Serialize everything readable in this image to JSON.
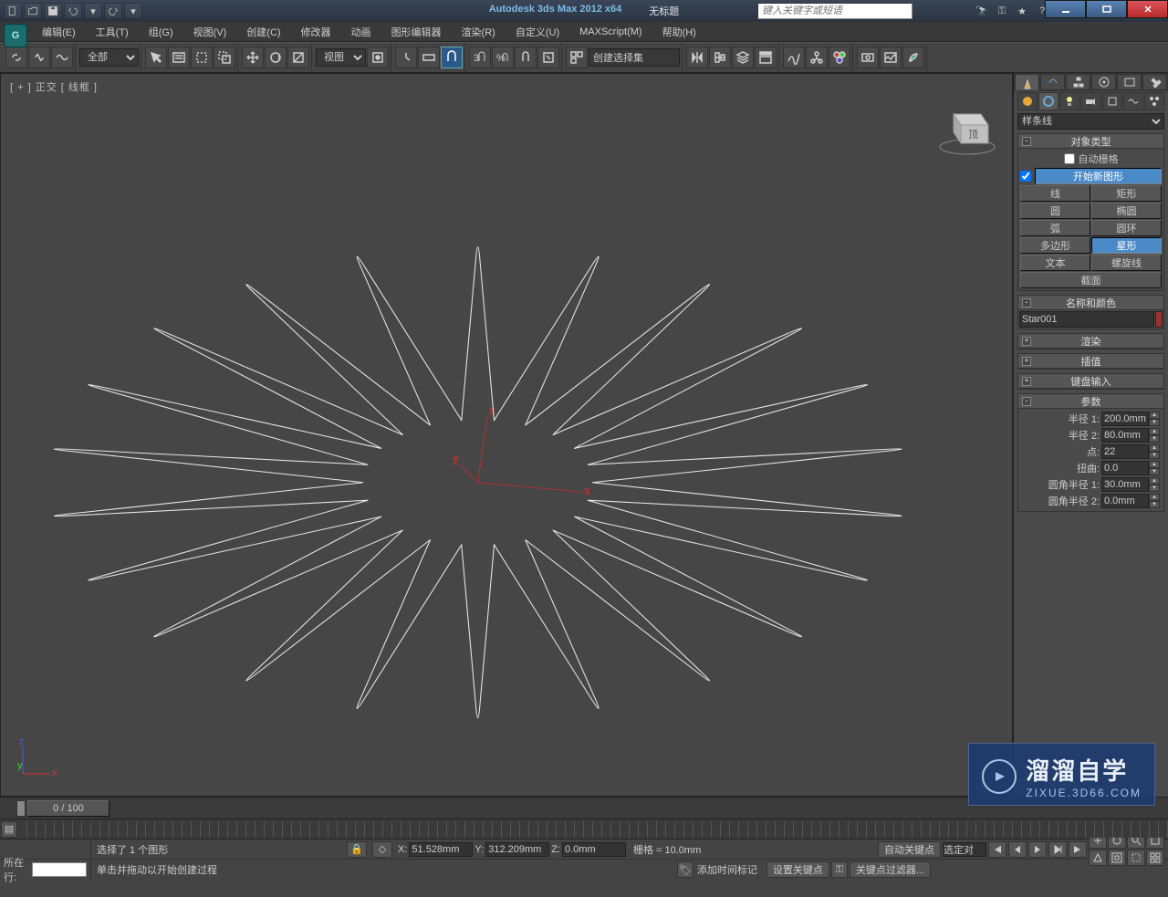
{
  "title": {
    "app": "Autodesk 3ds Max  2012 x64",
    "doc": "无标题",
    "search_ph": "键入关键字或短语"
  },
  "menus": [
    "编辑(E)",
    "工具(T)",
    "组(G)",
    "视图(V)",
    "创建(C)",
    "修改器",
    "动画",
    "图形编辑器",
    "渲染(R)",
    "自定义(U)",
    "MAXScript(M)",
    "帮助(H)"
  ],
  "toolbar": {
    "filter": "全部",
    "viewmode": "视图",
    "selset": "创建选择集"
  },
  "viewport": {
    "label": "[ + ] 正交 [ 线框 ]"
  },
  "panel": {
    "shape_cat": "样条线",
    "rollouts": {
      "obj_type": "对象类型",
      "autogrid": "自动栅格",
      "start_new": "开始新图形",
      "shapes": [
        "线",
        "矩形",
        "圆",
        "椭圆",
        "弧",
        "圆环",
        "多边形",
        "星形",
        "文本",
        "螺旋线",
        "截面"
      ],
      "name_color": "名称和颜色",
      "name_val": "Star001",
      "render": "渲染",
      "interp": "插值",
      "kbd": "键盘输入",
      "params": "参数"
    },
    "params": [
      {
        "l": "半径 1:",
        "v": "200.0mm"
      },
      {
        "l": "半径 2:",
        "v": "80.0mm"
      },
      {
        "l": "点:",
        "v": "22"
      },
      {
        "l": "扭曲:",
        "v": "0.0"
      },
      {
        "l": "圆角半径 1:",
        "v": "30.0mm"
      },
      {
        "l": "圆角半径 2:",
        "v": "0.0mm"
      }
    ]
  },
  "timeline": {
    "frame": "0 / 100"
  },
  "status": {
    "row_label": "所在行:",
    "sel_msg": "选择了 1 个图形",
    "hint": "单击并拖动以开始创建过程",
    "x": "51.528mm",
    "y": "312.209mm",
    "z": "0.0mm",
    "grid": "栅格 = 10.0mm",
    "add_tag": "添加时间标记",
    "auto_key": "自动关键点",
    "set_key": "设置关键点",
    "key_filter": "关键点过滤器...",
    "sel_drop": "选定对"
  },
  "watermark": {
    "big": "溜溜自学",
    "small": "ZIXUE.3D66.COM"
  }
}
